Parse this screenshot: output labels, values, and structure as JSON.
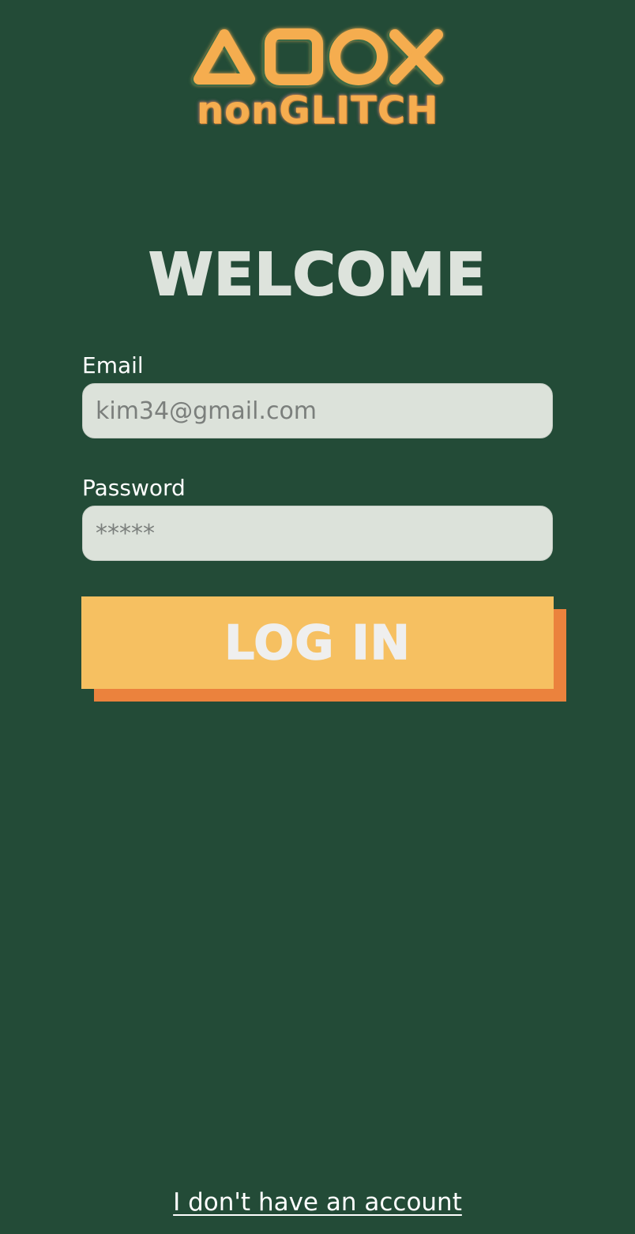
{
  "brand": {
    "logo_symbols": "△□○×",
    "logo_text": "nonGLITCH",
    "colors": {
      "background": "#234b37",
      "logo_orange": "#f5ad4f",
      "button": "#f6c061",
      "button_shadow": "#eb823d",
      "field_bg": "#dce2da"
    }
  },
  "heading": "WELCOME",
  "form": {
    "email_label": "Email",
    "email_value": "kim34@gmail.com",
    "password_label": "Password",
    "password_value": "*****"
  },
  "login_button_label": "LOG IN",
  "no_account_link": "I don't have an account"
}
